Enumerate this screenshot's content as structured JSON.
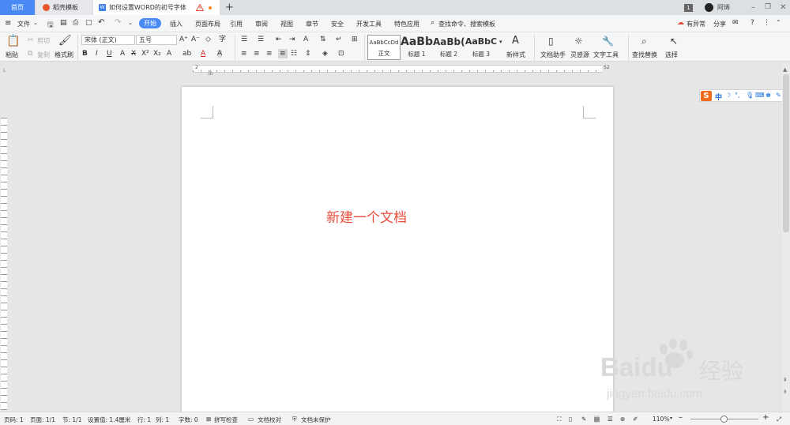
{
  "colors": {
    "accent": "#4a8af4",
    "doc_text": "#e74c3c",
    "logo_red": "#e2231a"
  },
  "tabs": {
    "home": "首页",
    "docer": "稻壳模板",
    "document": "如何设置WORD的初号字体",
    "new_tab": "+",
    "tab_count": "1",
    "user": "阿烯"
  },
  "menu": {
    "file": "文件",
    "items": [
      "开始",
      "插入",
      "页面布局",
      "引用",
      "审阅",
      "视图",
      "章节",
      "安全",
      "开发工具",
      "特色应用"
    ],
    "search": "查找命令、搜索模板",
    "anomaly": "有异常",
    "share": "分享"
  },
  "ribbon": {
    "paste": "粘贴",
    "cut": "剪切",
    "copy": "复制",
    "format_painter": "格式刷",
    "font_name": "宋体 (正文)",
    "font_size": "五号",
    "styles": [
      {
        "sample": "AaBbCcDd",
        "name": "正文"
      },
      {
        "sample": "AaBb",
        "name": "标题 1"
      },
      {
        "sample": "AaBb(",
        "name": "标题 2"
      },
      {
        "sample": "AaBbC",
        "name": "标题 3"
      }
    ],
    "new_style": "新样式",
    "doc_assistant": "文档助手",
    "inspiration": "灵感源",
    "text_tools": "文字工具",
    "find_replace": "查找替换",
    "select": "选择"
  },
  "ruler": {
    "start": "2",
    "end": "52"
  },
  "document": {
    "content": "新建一个文档"
  },
  "ime": {
    "label": "中"
  },
  "status": {
    "page_no": "页码: 1",
    "pages": "页面: 1/1",
    "section": "节: 1/1",
    "setting": "设置值: 1.4厘米",
    "row": "行: 1",
    "col": "列: 1",
    "words": "字数: 0",
    "spell": "拼写检查",
    "proof": "文档校对",
    "protect": "文档未保护",
    "zoom": "110%"
  },
  "watermark": {
    "brand": "Baidu",
    "cn": "经验",
    "url": "jingyan.baidu.com"
  }
}
